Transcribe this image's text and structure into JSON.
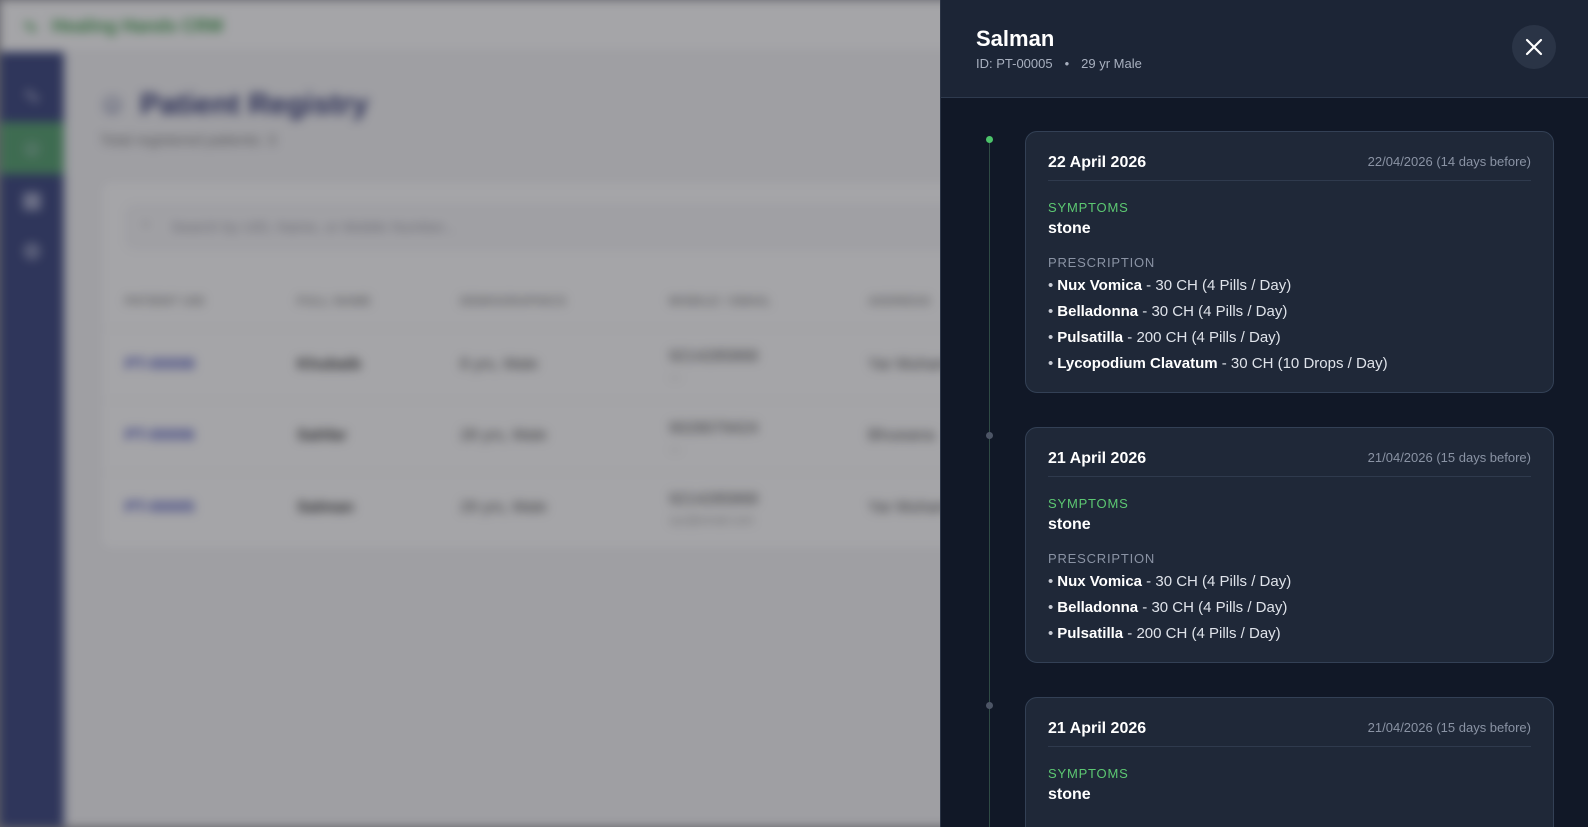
{
  "app": {
    "name": "Healing Hands CRM",
    "page_title": "Patient Registry",
    "subtitle": "Total registered patients: 3",
    "search_placeholder": "Search by UID, Name, or Mobile Number...",
    "columns": [
      "PATIENT UID",
      "FULL NAME",
      "DEMOGRAPHICS",
      "MOBILE / EMAIL",
      "ADDRESS"
    ],
    "rows": [
      {
        "uid": "PT-00008",
        "name": "Khubaib",
        "demo": "8 yrs, Male",
        "mobile": "9214285868",
        "email": "—",
        "address": "Yar Muhammad"
      },
      {
        "uid": "PT-00006",
        "name": "Sahfar",
        "demo": "28 yrs, Male",
        "mobile": "9028079424",
        "email": "—",
        "address": "Bhuwana"
      },
      {
        "uid": "PT-00005",
        "name": "Salman",
        "demo": "29 yrs, Male",
        "mobile": "9214285868",
        "email": "xyz@email.com",
        "address": "Yar Muhammad"
      }
    ]
  },
  "drawer": {
    "patient_name": "Salman",
    "patient_id": "ID: PT-00005",
    "separator": "•",
    "patient_demo": "29 yr Male",
    "visits": [
      {
        "date": "22 April 2026",
        "relative": "22/04/2026 (14 days before)",
        "symptoms_label": "SYMPTOMS",
        "symptoms": "stone",
        "prescription_label": "PRESCRIPTION",
        "prescriptions": [
          {
            "name": "Nux Vomica",
            "detail": " - 30 CH (4 Pills / Day)"
          },
          {
            "name": "Belladonna",
            "detail": " - 30 CH (4 Pills / Day)"
          },
          {
            "name": "Pulsatilla",
            "detail": " - 200 CH (4 Pills / Day)"
          },
          {
            "name": "Lycopodium Clavatum",
            "detail": " - 30 CH (10 Drops / Day)"
          }
        ]
      },
      {
        "date": "21 April 2026",
        "relative": "21/04/2026 (15 days before)",
        "symptoms_label": "SYMPTOMS",
        "symptoms": "stone",
        "prescription_label": "PRESCRIPTION",
        "prescriptions": [
          {
            "name": "Nux Vomica",
            "detail": " - 30 CH (4 Pills / Day)"
          },
          {
            "name": "Belladonna",
            "detail": " - 30 CH (4 Pills / Day)"
          },
          {
            "name": "Pulsatilla",
            "detail": " - 200 CH (4 Pills / Day)"
          }
        ]
      },
      {
        "date": "21 April 2026",
        "relative": "21/04/2026 (15 days before)",
        "symptoms_label": "SYMPTOMS",
        "symptoms": "stone"
      }
    ]
  },
  "colors": {
    "drawer_bg": "#111827",
    "card_bg": "#1f2838",
    "accent_green": "#5cc872",
    "sidebar": "#34407a"
  }
}
